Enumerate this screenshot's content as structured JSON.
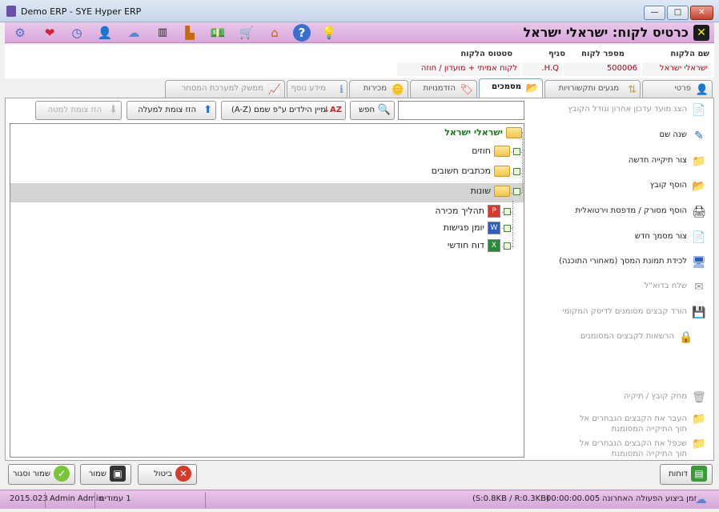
{
  "window": {
    "title": "Demo ERP - SYE Hyper ERP",
    "min": "—",
    "max": "□",
    "close": "✕"
  },
  "toolbar": {
    "icons": [
      "gear-icon",
      "heart-icon",
      "clock-icon",
      "users-icon",
      "cloud-icon",
      "barcode-icon",
      "factory-icon",
      "money-icon",
      "cart-icon",
      "home-icon",
      "help-icon",
      "bulb-icon"
    ],
    "page_title": "כרטיס לקוח: ישראלי ישראל",
    "close_label": "✕"
  },
  "customer": {
    "name_label": "שם הלקוח",
    "name_value": "ישראלי ישראל",
    "number_label": "מספר לקוח",
    "number_value": "500006",
    "branch_label": "סניף",
    "branch_value": "H.Q.",
    "status_label": "סטטוס הלקוח",
    "status_value": "לקוח אמיתי + מועדון / חוזה"
  },
  "tabs": [
    {
      "label": "פרטי התקשרות",
      "icon": "👤"
    },
    {
      "label": "מגעים ותקשורויות",
      "icon": "⇅"
    },
    {
      "label": "מסמכים",
      "icon": "📂"
    },
    {
      "label": "הזדמנויות",
      "icon": "🏷"
    },
    {
      "label": "מכירות",
      "icon": "🪙"
    },
    {
      "label": "מידע נוסף",
      "icon": "ℹ"
    },
    {
      "label": "ממשק למערכת המסחר",
      "icon": "📈"
    }
  ],
  "actions": [
    {
      "label": "הצג מועד עדכון אחרון וגודל הקובץ",
      "icon": "📄"
    },
    {
      "label": "שנה שם",
      "icon": "✎"
    },
    {
      "label": "צור תיקייה חדשה",
      "icon": "📁"
    },
    {
      "label": "הוסף קובץ",
      "icon": "📂"
    },
    {
      "label": "הוסף מסורק / מדפסת וירטואלית",
      "icon": "🖨"
    },
    {
      "label": "צור מסמך חדש",
      "icon": "📄"
    },
    {
      "label": "לכידת תמונת המסך (מאחורי התוכנה)",
      "icon": "🖥"
    },
    {
      "label": "שלח בדוא\"ל",
      "icon": "✉"
    },
    {
      "label": "הורד קבצים מסומנים לדיסק המקומי",
      "icon": "💾"
    },
    {
      "label": "הרשאות לקבצים המסומנים",
      "icon": "🔒"
    },
    {
      "label": "מחק קובץ / תיקיה",
      "icon": "🗑"
    },
    {
      "label": "העבר את הקבצים הנבחרים אל תוך התיקייה המסומנת",
      "icon": "📁"
    },
    {
      "label": "שכפל את הקבצים הנבחרים אל תוך התיקייה המסומנת",
      "icon": "📁"
    }
  ],
  "tree_toolbar": {
    "search_label": "חפש",
    "search_value": "",
    "sort_label": "מיין הילדים ע\"פ שמם (A-Z)",
    "move_up_label": "הזז צומת למעלה",
    "move_down_label": "הזז צומת למטה"
  },
  "tree": {
    "root": "ישראלי ישראל",
    "children": [
      {
        "label": "חוזים"
      },
      {
        "label": "מכתבים חשובים"
      },
      {
        "label": "שונות",
        "children": [
          {
            "label": "תהליך מכירה",
            "type": "pdf"
          },
          {
            "label": "יומן פגישות",
            "type": "word"
          },
          {
            "label": "דוח חודשי",
            "type": "excel"
          }
        ]
      }
    ]
  },
  "buttons": {
    "reports": "דוחות",
    "cancel": "ביטול",
    "save": "שמור",
    "save_close": "שמור וסגור"
  },
  "status": {
    "version": "2015.023",
    "user": "Admin Admin",
    "columns": "1 עמודים",
    "traffic": "(S:0.8KB / R:0.3KB)",
    "time": "00:00:00.005",
    "last_action": "זמן ביצוע הפעולה האחרונה"
  },
  "colors": {
    "accent": "#d9a7db",
    "root_green": "#1a7a1a",
    "value_red": "#b3001e"
  }
}
